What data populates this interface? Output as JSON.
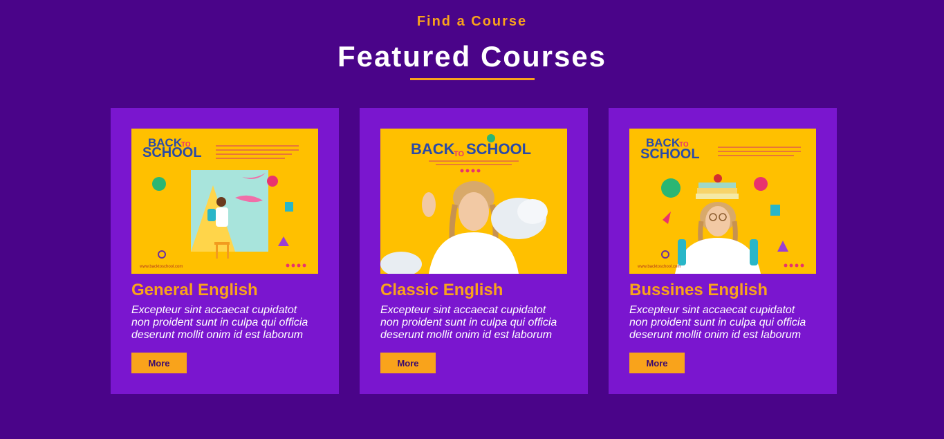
{
  "header": {
    "kicker": "Find a Course",
    "title": "Featured Courses"
  },
  "colors": {
    "background": "#4a0489",
    "card": "#7a16cf",
    "accent": "#f9a31b",
    "thumb": "#ffc000"
  },
  "courses": [
    {
      "image_text_line1": "BACK",
      "image_text_to": "TO",
      "image_text_line2": "SCHOOL",
      "image_footer": "www.backtoschool.com",
      "title": "General English",
      "description": "Excepteur sint accaecat cupidatot non proident sunt in culpa qui officia deserunt mollit onim id est laborum",
      "button": "More"
    },
    {
      "image_text_line1": "BACK",
      "image_text_to": "TO",
      "image_text_line2": "SCHOOL",
      "title": "Classic English",
      "description": "Excepteur sint accaecat cupidatot non proident sunt in culpa qui officia deserunt mollit onim id est laborum",
      "button": "More"
    },
    {
      "image_text_line1": "BACK",
      "image_text_to": "TO",
      "image_text_line2": "SCHOOL",
      "image_footer": "www.backtoschool.com",
      "title": "Bussines English",
      "description": "Excepteur sint accaecat cupidatot non proident sunt in culpa qui officia deserunt mollit onim id est laborum",
      "button": "More"
    }
  ]
}
